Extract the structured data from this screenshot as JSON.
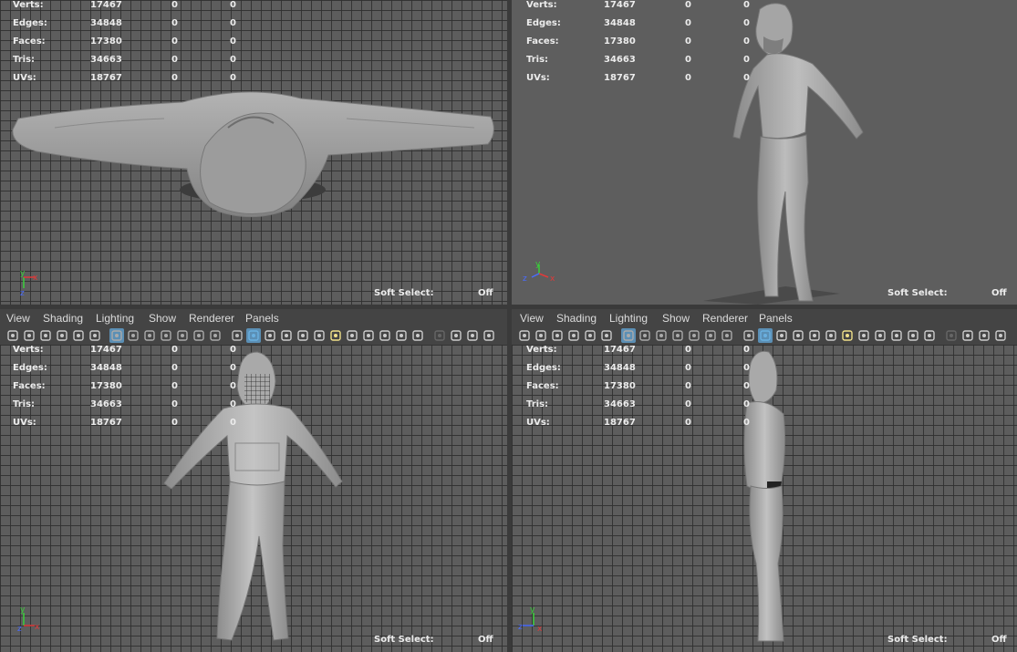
{
  "hud": {
    "labels": [
      "Verts:",
      "Edges:",
      "Faces:",
      "Tris:",
      "UVs:"
    ],
    "values": [
      [
        "17467",
        "0",
        "0"
      ],
      [
        "34848",
        "0",
        "0"
      ],
      [
        "17380",
        "0",
        "0"
      ],
      [
        "34663",
        "0",
        "0"
      ],
      [
        "18767",
        "0",
        "0"
      ]
    ]
  },
  "soft_select": {
    "label": "Soft Select:",
    "value": "Off"
  },
  "menu": [
    "View",
    "Shading",
    "Lighting",
    "Show",
    "Renderer",
    "Panels"
  ],
  "toolbar_icons": [
    "camera-select-icon",
    "camera-attributes-icon",
    "bookmark-icon",
    "image-plane-icon",
    "twod-pan-zoom-icon",
    "grease-pencil-icon",
    "grid-icon",
    "film-gate-icon",
    "resolution-gate-icon",
    "gate-mask-icon",
    "field-chart-icon",
    "safe-action-icon",
    "safe-title-icon",
    "wireframe-icon",
    "smooth-shade-icon",
    "use-default-material-icon",
    "wireframe-on-shaded-icon",
    "xray-icon",
    "textured-icon",
    "lights-icon",
    "shadows-icon",
    "screen-space-ao-icon",
    "motion-blur-icon",
    "multisample-aa-icon",
    "depth-of-field-icon",
    "isolate-select-icon",
    "xray-joints-icon",
    "xray-active-icon",
    "toggle-hud-icon"
  ],
  "axis_labels": {
    "x": "x",
    "y": "y",
    "z": "z"
  }
}
